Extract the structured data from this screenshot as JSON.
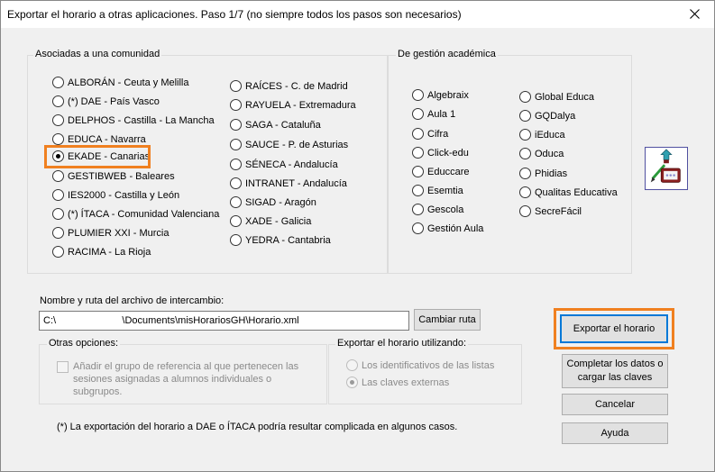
{
  "window": {
    "title": "Exportar el horario a otras aplicaciones.  Paso 1/7 (no siempre todos los pasos son necesarios)"
  },
  "community": {
    "label": "Asociadas a una comunidad",
    "col1": [
      {
        "label": "ALBORÁN - Ceuta y Melilla",
        "checked": false
      },
      {
        "label": "(*) DAE - País Vasco",
        "checked": false
      },
      {
        "label": "DELPHOS - Castilla - La Mancha",
        "checked": false
      },
      {
        "label": "EDUCA - Navarra",
        "checked": false
      },
      {
        "label": "EKADE - Canarias",
        "checked": true
      },
      {
        "label": "GESTIBWEB - Baleares",
        "checked": false
      },
      {
        "label": "IES2000 - Castilla y León",
        "checked": false
      },
      {
        "label": "(*) ÍTACA - Comunidad Valenciana",
        "checked": false
      },
      {
        "label": "PLUMIER XXI - Murcia",
        "checked": false
      },
      {
        "label": "RACIMA - La Rioja",
        "checked": false
      }
    ],
    "col2": [
      {
        "label": "RAÍCES - C. de Madrid",
        "checked": false
      },
      {
        "label": "RAYUELA - Extremadura",
        "checked": false
      },
      {
        "label": "SAGA - Cataluña",
        "checked": false
      },
      {
        "label": "SAUCE - P. de Asturias",
        "checked": false
      },
      {
        "label": "SÉNECA - Andalucía",
        "checked": false
      },
      {
        "label": "INTRANET - Andalucía",
        "checked": false
      },
      {
        "label": "SIGAD - Aragón",
        "checked": false
      },
      {
        "label": "XADE - Galicia",
        "checked": false
      },
      {
        "label": "YEDRA - Cantabria",
        "checked": false
      }
    ]
  },
  "academic": {
    "label": "De gestión académica",
    "col1": [
      {
        "label": "Algebraix"
      },
      {
        "label": "Aula 1"
      },
      {
        "label": "Cifra"
      },
      {
        "label": "Click-edu"
      },
      {
        "label": "Educcare"
      },
      {
        "label": "Esemtia"
      },
      {
        "label": "Gescola"
      },
      {
        "label": "Gestión Aula"
      }
    ],
    "col2": [
      {
        "label": "Global Educa"
      },
      {
        "label": "GQDalya"
      },
      {
        "label": "iEduca"
      },
      {
        "label": "Oduca"
      },
      {
        "label": "Phidias"
      },
      {
        "label": "Qualitas Educativa"
      },
      {
        "label": "SecreFácil"
      }
    ]
  },
  "file": {
    "label": "Nombre y ruta del archivo de intercambio:",
    "value": "C:\\                        \\Documents\\misHorariosGH\\Horario.xml",
    "change_button": "Cambiar ruta"
  },
  "other_options": {
    "label": "Otras opciones:",
    "checkbox_label": "Añadir el grupo de referencia al que pertenecen las sesiones asignadas a alumnos individuales o subgrupos."
  },
  "export_using": {
    "label": "Exportar el horario utilizando:",
    "options": [
      {
        "label": "Los identificativos de las listas",
        "checked": false
      },
      {
        "label": "Las claves externas",
        "checked": true
      }
    ]
  },
  "buttons": {
    "export": "Exportar el horario",
    "complete": "Completar los datos o cargar las claves",
    "cancel": "Cancelar",
    "help": "Ayuda"
  },
  "note": "(*) La exportación del horario a DAE o ÍTACA podría resultar complicada en algunos casos.",
  "colors": {
    "highlight": "#f08020",
    "default_button_border": "#0078d7"
  }
}
